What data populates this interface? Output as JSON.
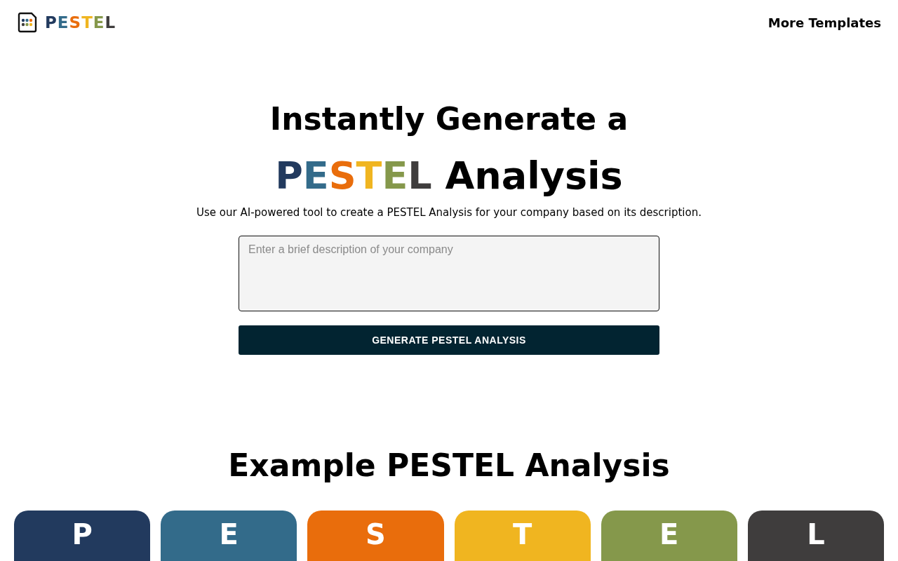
{
  "header": {
    "logo_letters": [
      {
        "text": "P",
        "color": "#223a5e"
      },
      {
        "text": "E",
        "color": "#336b8a"
      },
      {
        "text": "S",
        "color": "#e96d0c"
      },
      {
        "text": "T",
        "color": "#f0b520"
      },
      {
        "text": "E",
        "color": "#85984b"
      },
      {
        "text": "L",
        "color": "#3f3d3d"
      }
    ],
    "nav_link": "More Templates"
  },
  "hero": {
    "title_line": "Instantly Generate a",
    "title_letters": [
      {
        "text": "P",
        "color": "#223a5e"
      },
      {
        "text": "E",
        "color": "#336b8a"
      },
      {
        "text": "S",
        "color": "#e96d0c"
      },
      {
        "text": "T",
        "color": "#f0b520"
      },
      {
        "text": "E",
        "color": "#85984b"
      },
      {
        "text": "L",
        "color": "#3f3d3d"
      }
    ],
    "title_rest": "Analysis",
    "subtitle": "Use our AI-powered tool to create a PESTEL Analysis for your company based on its description.",
    "input": {
      "placeholder": "Enter a brief description of your company"
    },
    "button": "GENERATE PESTEL ANALYSIS"
  },
  "example": {
    "title": "Example PESTEL Analysis",
    "cards": [
      {
        "letter": "P",
        "color": "#223a5e"
      },
      {
        "letter": "E",
        "color": "#336b8a"
      },
      {
        "letter": "S",
        "color": "#e96d0c"
      },
      {
        "letter": "T",
        "color": "#f0b520"
      },
      {
        "letter": "E",
        "color": "#85984b"
      },
      {
        "letter": "L",
        "color": "#3f3d3d"
      }
    ]
  }
}
